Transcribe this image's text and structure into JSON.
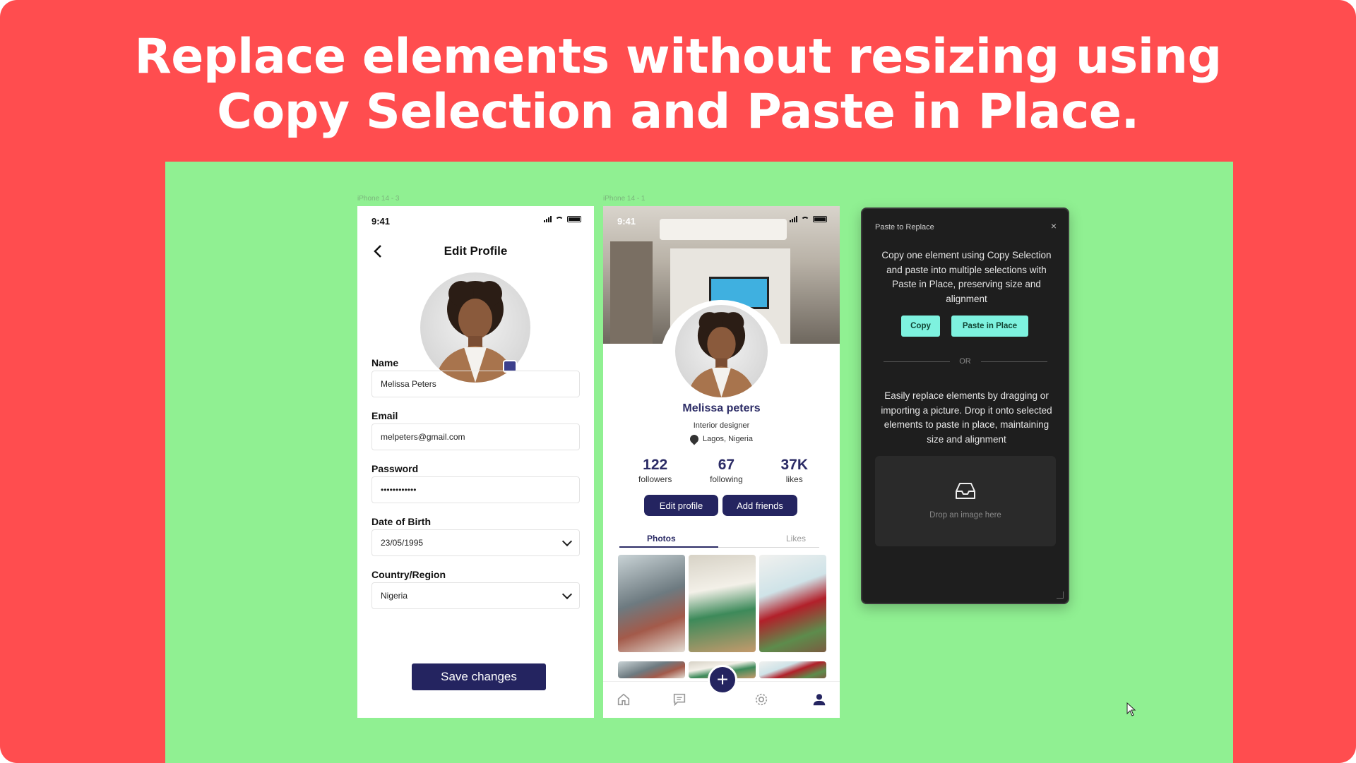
{
  "headline": {
    "line1": "Replace elements without resizing using",
    "line2": "Copy Selection and Paste in Place."
  },
  "frames": {
    "left_label": "iPhone 14 - 3",
    "right_label": "iPhone 14 - 1"
  },
  "edit_profile": {
    "time": "9:41",
    "title": "Edit Profile",
    "name_label": "Name",
    "name_value": "Melissa Peters",
    "email_label": "Email",
    "email_value": "melpeters@gmail.com",
    "password_label": "Password",
    "password_value": "••••••••••••",
    "dob_label": "Date of Birth",
    "dob_value": "23/05/1995",
    "country_label": "Country/Region",
    "country_value": "Nigeria",
    "save_label": "Save changes"
  },
  "profile": {
    "time": "9:41",
    "name": "Melissa peters",
    "role": "Interior designer",
    "location": "Lagos, Nigeria",
    "stats": [
      {
        "num": "122",
        "label": "followers"
      },
      {
        "num": "67",
        "label": "following"
      },
      {
        "num": "37K",
        "label": "likes"
      }
    ],
    "edit_label": "Edit profile",
    "add_label": "Add friends",
    "tab_photos": "Photos",
    "tab_likes": "Likes",
    "fab": "+"
  },
  "panel": {
    "title": "Paste to Replace",
    "close": "×",
    "description": "Copy one element using Copy Selection and paste into multiple selections with Paste in Place, preserving size and alignment",
    "copy_label": "Copy",
    "paste_label": "Paste in Place",
    "or_label": "OR",
    "description2": "Easily replace elements by dragging or importing a picture. Drop it onto selected elements to paste in place, maintaining size and alignment",
    "drop_label": "Drop an image here"
  },
  "colors": {
    "banner": "#ff4d4f",
    "canvas": "#90f092",
    "primary": "#242460",
    "accent": "#7ef2df",
    "panel_bg": "#1e1e1e"
  }
}
